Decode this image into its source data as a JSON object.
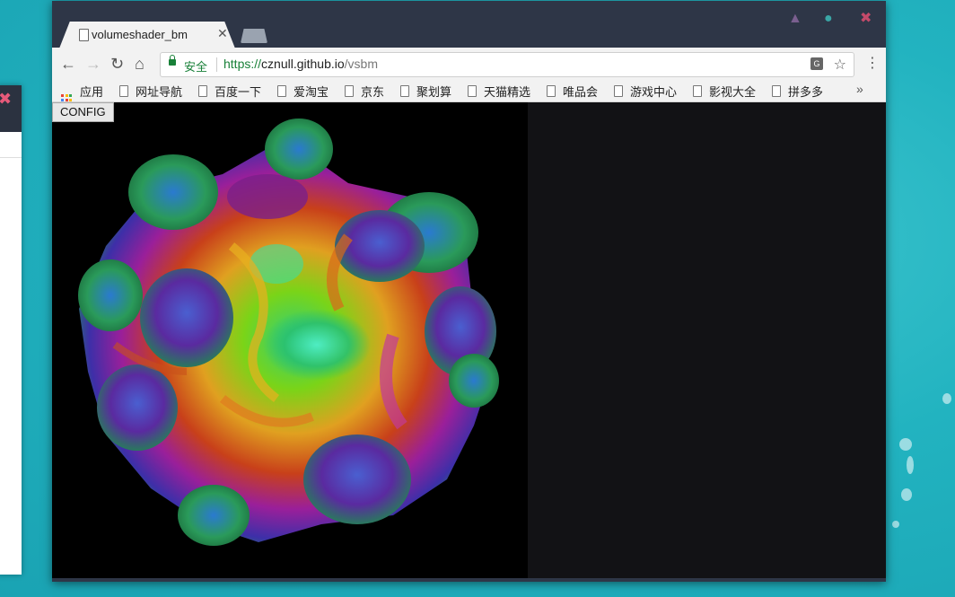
{
  "tab": {
    "title": "volumeshader_bm"
  },
  "toolbar": {
    "secure_label": "安全",
    "url_scheme": "https://",
    "url_host": "cznull.github.io",
    "url_path": "/vsbm"
  },
  "bookmarks": {
    "items": [
      "应用",
      "网址导航",
      "百度一下",
      "爱淘宝",
      "京东",
      "聚划算",
      "天猫精选",
      "唯品会",
      "游戏中心",
      "影视大全",
      "拼多多"
    ],
    "more": "»"
  },
  "page": {
    "config_label": "CONFIG"
  },
  "colors": {
    "secure": "#188038",
    "window_frame": "#2e3647",
    "desktop": "#22b3c0"
  }
}
